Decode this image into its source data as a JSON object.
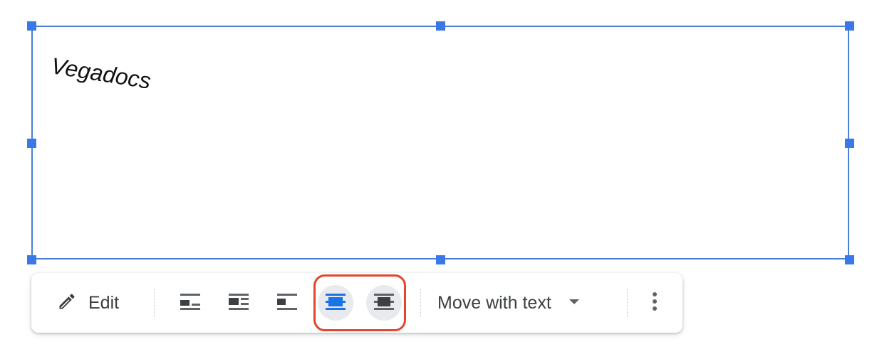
{
  "drawing": {
    "text": "Vegadocs"
  },
  "toolbar": {
    "edit_label": "Edit",
    "wrap_options": [
      {
        "name": "in-line",
        "icon": "wrap-inline-icon",
        "active": false
      },
      {
        "name": "wrap-text",
        "icon": "wrap-text-icon",
        "active": false
      },
      {
        "name": "break-text",
        "icon": "break-text-icon",
        "active": false
      },
      {
        "name": "behind-text",
        "icon": "behind-text-icon",
        "active": true
      },
      {
        "name": "in-front-of-text",
        "icon": "in-front-of-text-icon",
        "active": false
      }
    ],
    "position_dropdown": {
      "selected": "Move with text",
      "icon": "dropdown-arrow-icon"
    },
    "more_icon": "more-vert-icon"
  },
  "colors": {
    "selection": "#3b78e7",
    "active_icon": "#1a73e8",
    "icon": "#5f6368",
    "highlight": "#e2462c"
  }
}
